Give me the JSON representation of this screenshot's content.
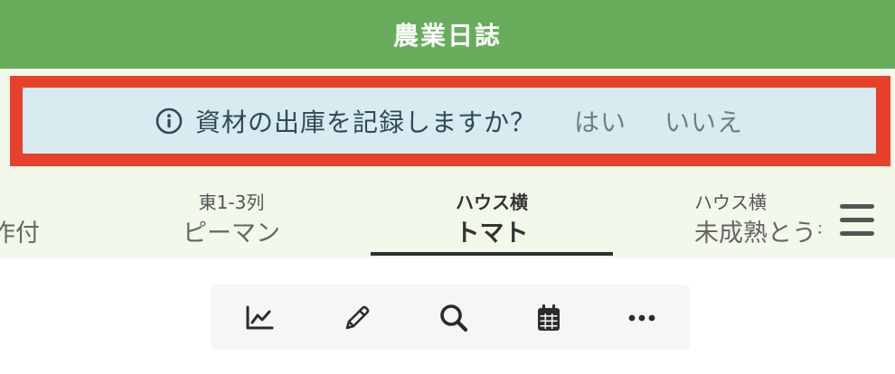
{
  "header": {
    "title": "農業日誌"
  },
  "alert": {
    "icon": "info-circle-icon",
    "message": "資材の出庫を記録しますか？",
    "yes_label": "はい",
    "no_label": "いいえ",
    "highlight_color": "#e8412b"
  },
  "tabs": {
    "items": [
      {
        "location": "",
        "crop": "作付"
      },
      {
        "location": "東1-3列",
        "crop": "ピーマン"
      },
      {
        "location": "ハウス横",
        "crop": "トマト",
        "active": true
      },
      {
        "location": "ハウス横",
        "crop": "未成熟とうもろこし"
      }
    ],
    "menu_icon": "hamburger-menu-icon"
  },
  "toolbar": {
    "items": [
      {
        "icon": "chart-line-icon"
      },
      {
        "icon": "pencil-icon"
      },
      {
        "icon": "search-icon"
      },
      {
        "icon": "calendar-icon"
      },
      {
        "icon": "more-horizontal-icon"
      }
    ]
  },
  "colors": {
    "header_bg": "#68ad5c",
    "tabs_bg": "#f2f8ea",
    "alert_bg": "#d8ebf0"
  }
}
